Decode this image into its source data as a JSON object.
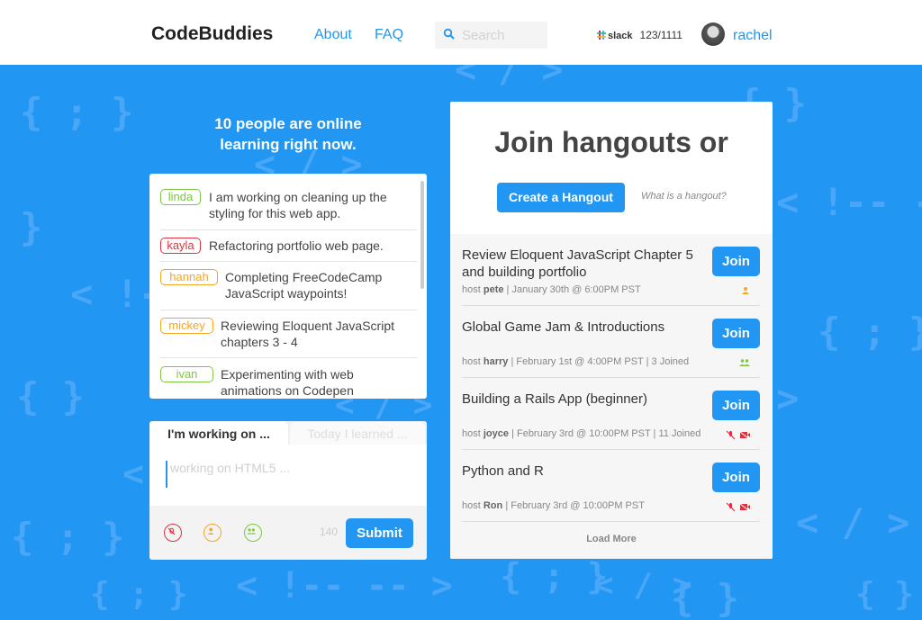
{
  "header": {
    "logo": "CodeBuddies",
    "nav": [
      {
        "label": "About"
      },
      {
        "label": "FAQ"
      }
    ],
    "search_placeholder": "Search",
    "slack_label": "slack",
    "slack_count": "123/1111",
    "username": "rachel"
  },
  "background": {
    "snippets": [
      "{ ; }",
      "< / >",
      "}",
      "< !--",
      "{ }",
      "{ ; }",
      "< !-- --",
      "{ ; }",
      "< / >",
      "< !-- -- >",
      "{ }",
      "< / >",
      "{ ; }",
      ">",
      "< / >",
      "{ }",
      "{ ; }",
      "<",
      "< / >",
      "{ }"
    ]
  },
  "online": {
    "line1": "10 people are online",
    "line2": "learning right now."
  },
  "feed": [
    {
      "user": "linda",
      "color": "#7cc843",
      "text": "I am working on cleaning up the styling for this web app."
    },
    {
      "user": "kayla",
      "color": "#d9343f",
      "text": "Refactoring portfolio web page."
    },
    {
      "user": "hannah",
      "color": "#f5a623",
      "text": "Completing FreeCodeCamp JavaScript waypoints!"
    },
    {
      "user": "mickey",
      "color": "#f5a623",
      "text": "Reviewing Eloquent JavaScript chapters 3 - 4"
    },
    {
      "user": "ivan",
      "color": "#7cc843",
      "text": "Experimenting with web animations on Codepen"
    }
  ],
  "composer": {
    "tab_active": "I'm working on ...",
    "tab_inactive": "Today I learned ...",
    "placeholder": "working on HTML5 ...",
    "char_count": "140",
    "submit": "Submit",
    "icon_colors": [
      "#d9343f",
      "#f5a623",
      "#7cc843"
    ]
  },
  "hangouts": {
    "title": "Join hangouts or",
    "create_label": "Create a Hangout",
    "what_label": "What is a hangout?",
    "join_label": "Join",
    "host_label": "host",
    "items": [
      {
        "title": "Review Eloquent JavaScript Chapter 5 and building portfolio",
        "host": "pete",
        "details": "| January 30th @ 6:00PM PST",
        "icon": "person-icon"
      },
      {
        "title": "Global Game Jam & Introductions",
        "host": "harry",
        "details": "| February 1st @ 4:00PM PST | 3 Joined",
        "icon": "group-icon"
      },
      {
        "title": "Building a Rails App (beginner)",
        "host": "joyce",
        "details": "| February 3rd @ 10:00PM PST | 11 Joined",
        "icon": "muted-icon"
      },
      {
        "title": "Python and R",
        "host": "Ron",
        "details": "| February 3rd @ 10:00PM PST",
        "icon": "muted-icon"
      }
    ],
    "load_more": "Load More"
  },
  "colors": {
    "accent": "#2196f3",
    "background": "#2196f3"
  }
}
